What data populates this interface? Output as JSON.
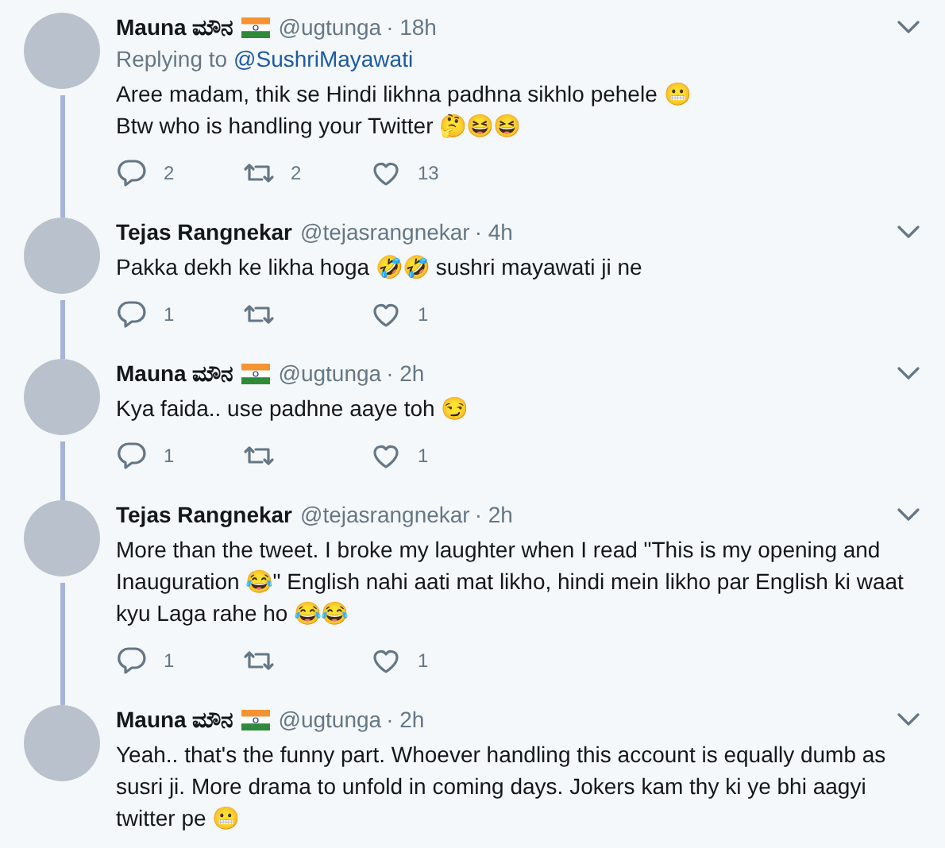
{
  "tweets": [
    {
      "name": "Mauna ಮೌನ",
      "flag": true,
      "handle": "@ugtunga",
      "time": "· 18h",
      "replying_to": {
        "label": "Replying to",
        "user": "@SushriMayawati"
      },
      "lines": [
        "Aree madam, thik se Hindi likhna padhna sikhlo pehele 😬",
        "Btw who is handling your Twitter 🤔😆😆"
      ],
      "actions": {
        "replies": "2",
        "retweets": "2",
        "likes": "13"
      }
    },
    {
      "name": "Tejas Rangnekar",
      "flag": false,
      "handle": "@tejasrangnekar",
      "time": "· 4h",
      "lines": [
        "Pakka dekh ke likha hoga 🤣🤣 sushri mayawati ji ne"
      ],
      "actions": {
        "replies": "1",
        "likes": "1"
      }
    },
    {
      "name": "Mauna ಮೌನ",
      "flag": true,
      "handle": "@ugtunga",
      "time": "· 2h",
      "lines": [
        "Kya faida.. use padhne aaye toh 😏"
      ],
      "actions": {
        "replies": "1",
        "likes": "1"
      }
    },
    {
      "name": "Tejas Rangnekar",
      "flag": false,
      "handle": "@tejasrangnekar",
      "time": "· 2h",
      "lines": [
        "More than the tweet. I broke my laughter when I read \"This is my opening and Inauguration 😂\" English nahi aati mat likho, hindi mein likho par English ki waat kyu Laga rahe ho 😂😂"
      ],
      "actions": {
        "replies": "1",
        "likes": "1"
      }
    },
    {
      "name": "Mauna ಮೌನ",
      "flag": true,
      "handle": "@ugtunga",
      "time": "· 2h",
      "lines": [
        "Yeah.. that's the funny part. Whoever handling this account is equally dumb as susri ji. More drama to unfold in coming days. Jokers kam thy ki ye bhi aagyi twitter pe 😬"
      ]
    }
  ]
}
